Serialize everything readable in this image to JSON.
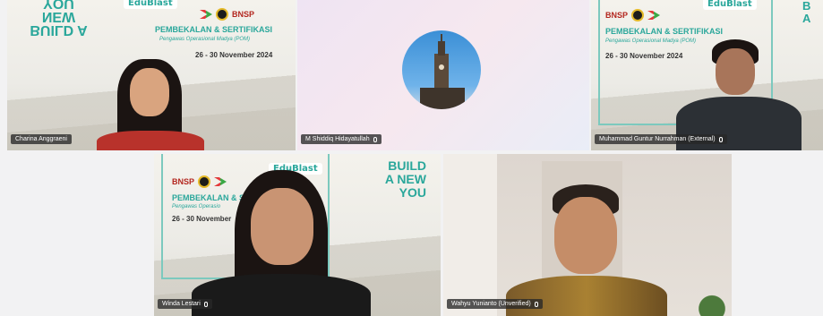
{
  "participants": [
    {
      "name": "Charina Anggraeni",
      "banner": {
        "headline_mirrored": "BUILD A NEW YOU",
        "brand": "EduBlast",
        "org": "BNSP",
        "title": "PEMBEKALAN & SERTIFIKASI",
        "subtitle": "Pengawas Operasional Madya (POM)",
        "dates": "26 - 30 November 2024"
      }
    },
    {
      "name": "M Shiddiq Hidayatullah",
      "avatar_icon": "tower-avatar-icon"
    },
    {
      "name": "Muhammad Guntur Nurrahman (External)",
      "banner": {
        "org": "BNSP",
        "brand": "EduBlast",
        "title": "PEMBEKALAN & SERTIFIKASI",
        "subtitle": "Pengawas Operasional Madya (POM)",
        "dates": "26 - 30 November 2024",
        "headline_partial": "B A"
      }
    },
    {
      "name": "Winda Lestari",
      "banner": {
        "org": "BNSP",
        "brand": "EduBlast",
        "title": "PEMBEKALAN & S",
        "subtitle": "Pengawas Operasio",
        "dates": "26 - 30 November",
        "headline": [
          "BUILD",
          "A NEW",
          "YOU"
        ]
      }
    },
    {
      "name": "Wahyu Yunianto (Unverified)"
    }
  ],
  "colors": {
    "accent_teal": "#2aa79b",
    "label_bg": "#282828"
  }
}
